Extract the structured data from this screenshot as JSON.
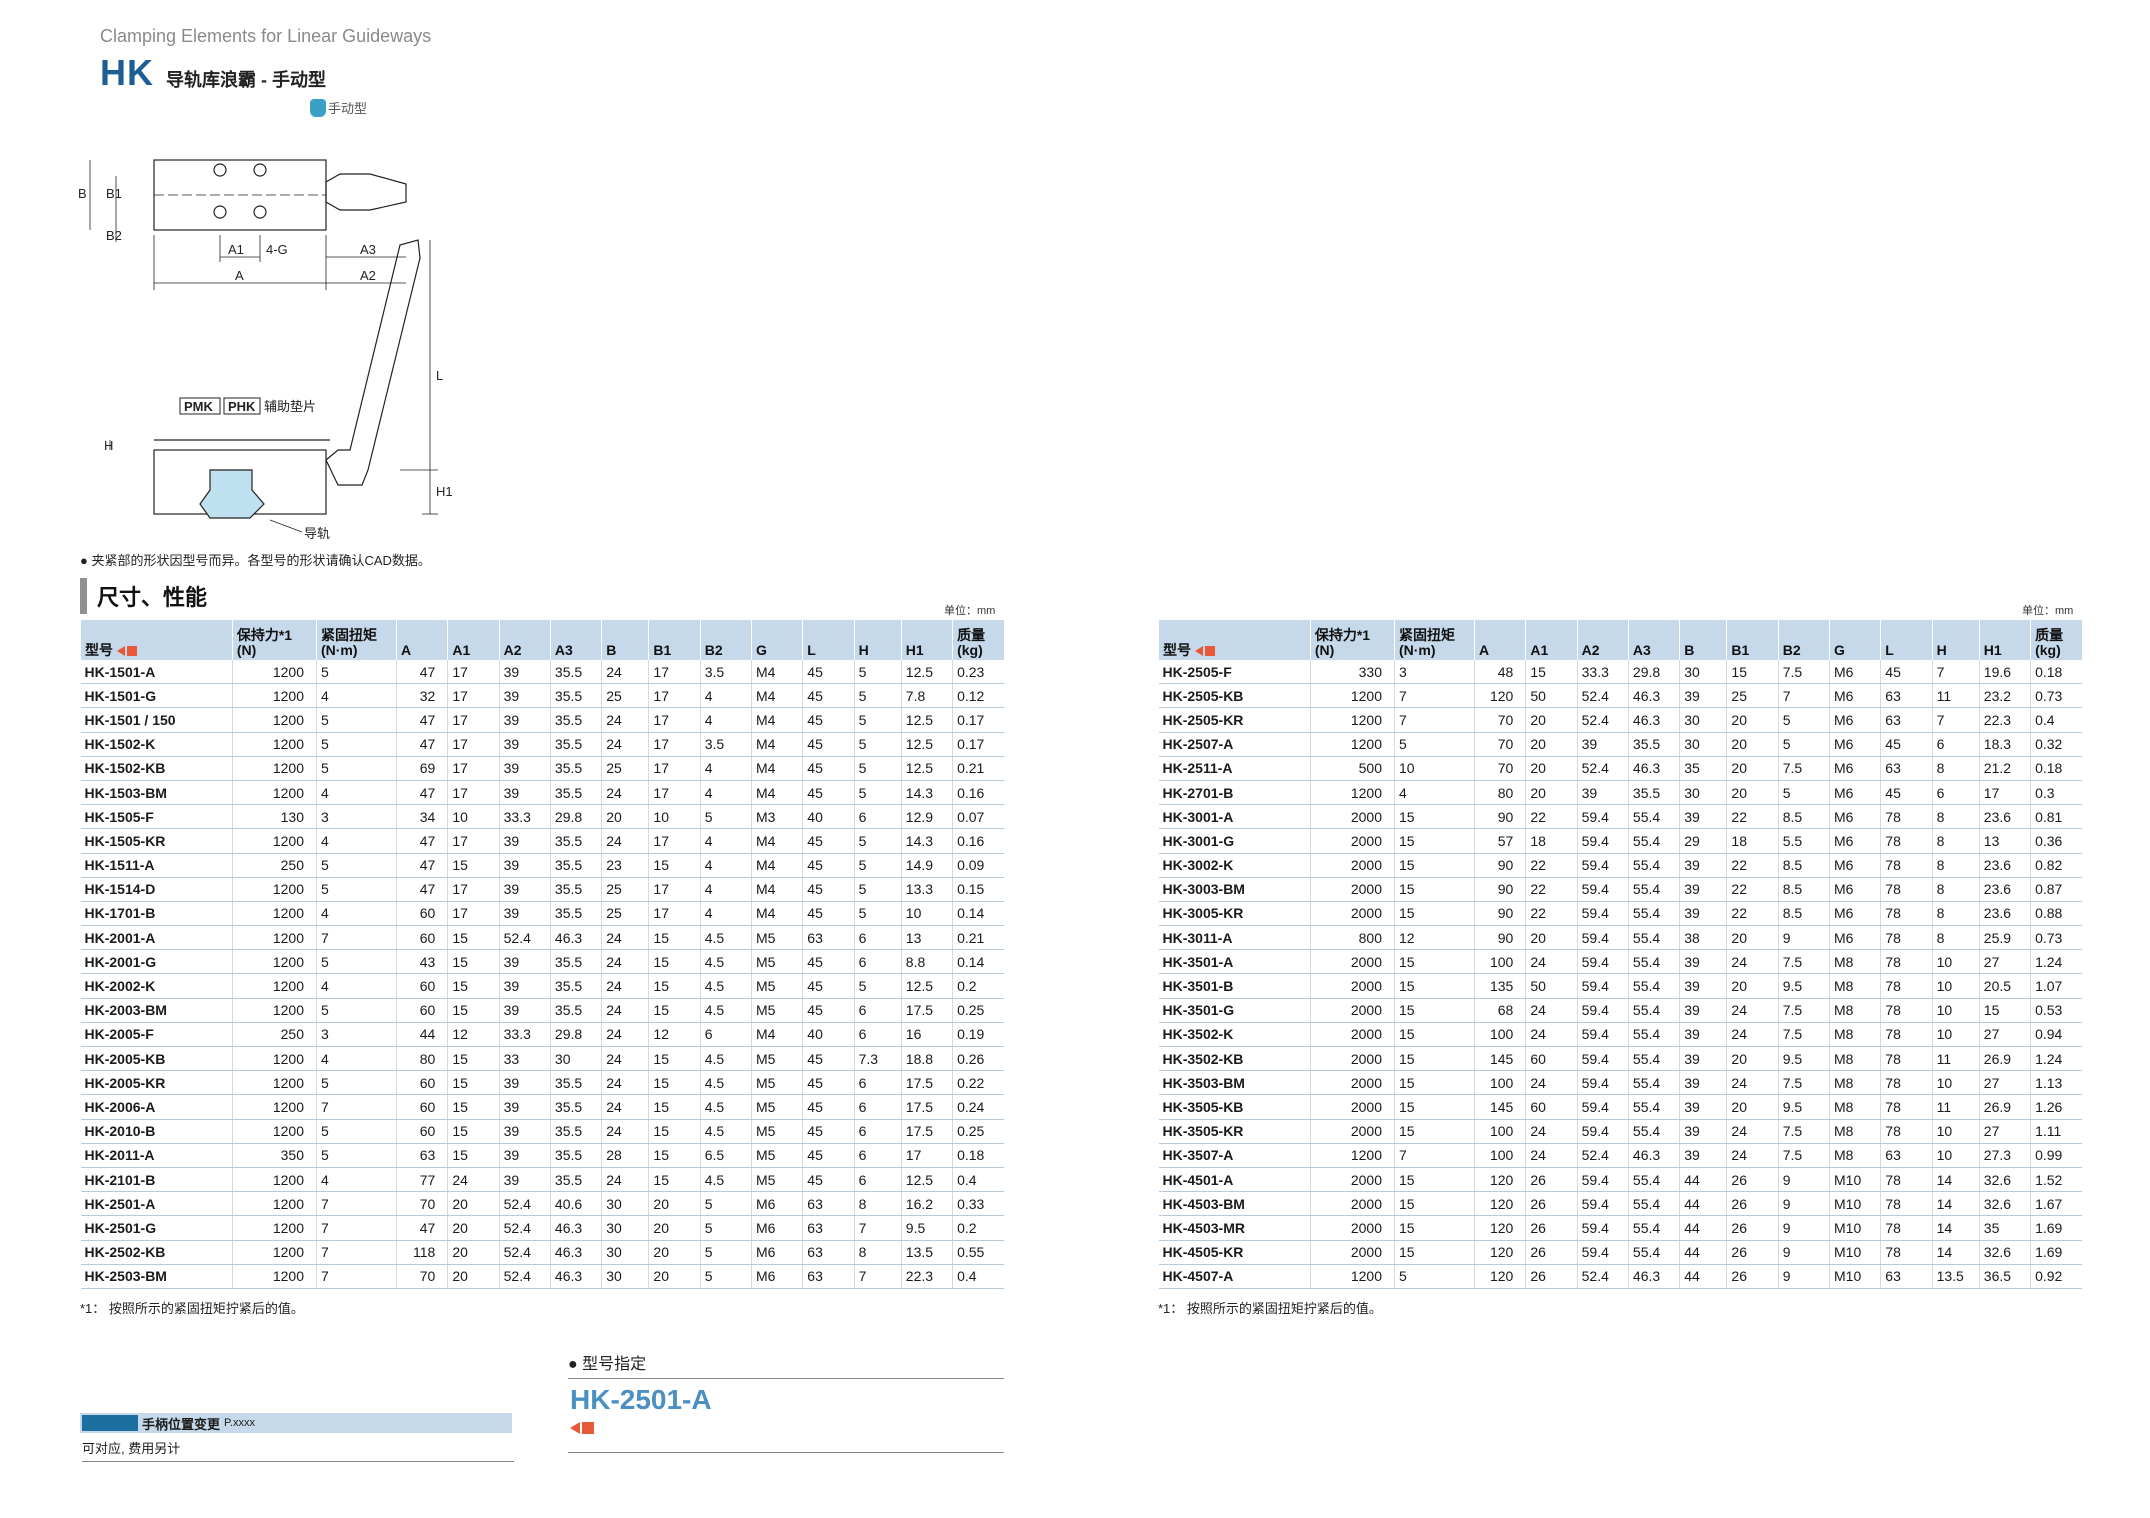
{
  "header": {
    "subtitle": "Clamping Elements for Linear Guideways",
    "code": "HK",
    "description": "导轨库浪霸 - 手动型",
    "type_badge": "手动型"
  },
  "drawing": {
    "top_labels": [
      "B",
      "B1",
      "B2",
      "A1",
      "4-G",
      "A3",
      "A",
      "A2"
    ],
    "side_labels": [
      "H",
      "L",
      "H1"
    ],
    "pmk": "PMK",
    "phk": "PHK",
    "pad_label": "辅助垫片",
    "rail_label": "导轨"
  },
  "note": "● 夹紧部的形状因型号而异。各型号的形状请确认CAD数据。",
  "section": {
    "title": "尺寸、性能",
    "unit": "单位：mm"
  },
  "columns": [
    "型号",
    "保持力*1 (N)",
    "紧固扭矩 (N·m)",
    "A",
    "A1",
    "A2",
    "A3",
    "B",
    "B1",
    "B2",
    "G",
    "L",
    "H",
    "H1",
    "质量 (kg)"
  ],
  "table_left": [
    [
      "HK-1501-A",
      "1200",
      "5",
      "47",
      "17",
      "39",
      "35.5",
      "24",
      "17",
      "3.5",
      "M4",
      "45",
      "5",
      "12.5",
      "0.23"
    ],
    [
      "HK-1501-G",
      "1200",
      "4",
      "32",
      "17",
      "39",
      "35.5",
      "25",
      "17",
      "4",
      "M4",
      "45",
      "5",
      "7.8",
      "0.12"
    ],
    [
      "HK-1501 / 150",
      "1200",
      "5",
      "47",
      "17",
      "39",
      "35.5",
      "24",
      "17",
      "4",
      "M4",
      "45",
      "5",
      "12.5",
      "0.17"
    ],
    [
      "HK-1502-K",
      "1200",
      "5",
      "47",
      "17",
      "39",
      "35.5",
      "24",
      "17",
      "3.5",
      "M4",
      "45",
      "5",
      "12.5",
      "0.17"
    ],
    [
      "HK-1502-KB",
      "1200",
      "5",
      "69",
      "17",
      "39",
      "35.5",
      "25",
      "17",
      "4",
      "M4",
      "45",
      "5",
      "12.5",
      "0.21"
    ],
    [
      "HK-1503-BM",
      "1200",
      "4",
      "47",
      "17",
      "39",
      "35.5",
      "24",
      "17",
      "4",
      "M4",
      "45",
      "5",
      "14.3",
      "0.16"
    ],
    [
      "HK-1505-F",
      "130",
      "3",
      "34",
      "10",
      "33.3",
      "29.8",
      "20",
      "10",
      "5",
      "M3",
      "40",
      "6",
      "12.9",
      "0.07"
    ],
    [
      "HK-1505-KR",
      "1200",
      "4",
      "47",
      "17",
      "39",
      "35.5",
      "24",
      "17",
      "4",
      "M4",
      "45",
      "5",
      "14.3",
      "0.16"
    ],
    [
      "HK-1511-A",
      "250",
      "5",
      "47",
      "15",
      "39",
      "35.5",
      "23",
      "15",
      "4",
      "M4",
      "45",
      "5",
      "14.9",
      "0.09"
    ],
    [
      "HK-1514-D",
      "1200",
      "5",
      "47",
      "17",
      "39",
      "35.5",
      "25",
      "17",
      "4",
      "M4",
      "45",
      "5",
      "13.3",
      "0.15"
    ],
    [
      "HK-1701-B",
      "1200",
      "4",
      "60",
      "17",
      "39",
      "35.5",
      "25",
      "17",
      "4",
      "M4",
      "45",
      "5",
      "10",
      "0.14"
    ],
    [
      "HK-2001-A",
      "1200",
      "7",
      "60",
      "15",
      "52.4",
      "46.3",
      "24",
      "15",
      "4.5",
      "M5",
      "63",
      "6",
      "13",
      "0.21"
    ],
    [
      "HK-2001-G",
      "1200",
      "5",
      "43",
      "15",
      "39",
      "35.5",
      "24",
      "15",
      "4.5",
      "M5",
      "45",
      "6",
      "8.8",
      "0.14"
    ],
    [
      "HK-2002-K",
      "1200",
      "4",
      "60",
      "15",
      "39",
      "35.5",
      "24",
      "15",
      "4.5",
      "M5",
      "45",
      "5",
      "12.5",
      "0.2"
    ],
    [
      "HK-2003-BM",
      "1200",
      "5",
      "60",
      "15",
      "39",
      "35.5",
      "24",
      "15",
      "4.5",
      "M5",
      "45",
      "6",
      "17.5",
      "0.25"
    ],
    [
      "HK-2005-F",
      "250",
      "3",
      "44",
      "12",
      "33.3",
      "29.8",
      "24",
      "12",
      "6",
      "M4",
      "40",
      "6",
      "16",
      "0.19"
    ],
    [
      "HK-2005-KB",
      "1200",
      "4",
      "80",
      "15",
      "33",
      "30",
      "24",
      "15",
      "4.5",
      "M5",
      "45",
      "7.3",
      "18.8",
      "0.26"
    ],
    [
      "HK-2005-KR",
      "1200",
      "5",
      "60",
      "15",
      "39",
      "35.5",
      "24",
      "15",
      "4.5",
      "M5",
      "45",
      "6",
      "17.5",
      "0.22"
    ],
    [
      "HK-2006-A",
      "1200",
      "7",
      "60",
      "15",
      "39",
      "35.5",
      "24",
      "15",
      "4.5",
      "M5",
      "45",
      "6",
      "17.5",
      "0.24"
    ],
    [
      "HK-2010-B",
      "1200",
      "5",
      "60",
      "15",
      "39",
      "35.5",
      "24",
      "15",
      "4.5",
      "M5",
      "45",
      "6",
      "17.5",
      "0.25"
    ],
    [
      "HK-2011-A",
      "350",
      "5",
      "63",
      "15",
      "39",
      "35.5",
      "28",
      "15",
      "6.5",
      "M5",
      "45",
      "6",
      "17",
      "0.18"
    ],
    [
      "HK-2101-B",
      "1200",
      "4",
      "77",
      "24",
      "39",
      "35.5",
      "24",
      "15",
      "4.5",
      "M5",
      "45",
      "6",
      "12.5",
      "0.4"
    ],
    [
      "HK-2501-A",
      "1200",
      "7",
      "70",
      "20",
      "52.4",
      "40.6",
      "30",
      "20",
      "5",
      "M6",
      "63",
      "8",
      "16.2",
      "0.33"
    ],
    [
      "HK-2501-G",
      "1200",
      "7",
      "47",
      "20",
      "52.4",
      "46.3",
      "30",
      "20",
      "5",
      "M6",
      "63",
      "7",
      "9.5",
      "0.2"
    ],
    [
      "HK-2502-KB",
      "1200",
      "7",
      "118",
      "20",
      "52.4",
      "46.3",
      "30",
      "20",
      "5",
      "M6",
      "63",
      "8",
      "13.5",
      "0.55"
    ],
    [
      "HK-2503-BM",
      "1200",
      "7",
      "70",
      "20",
      "52.4",
      "46.3",
      "30",
      "20",
      "5",
      "M6",
      "63",
      "7",
      "22.3",
      "0.4"
    ]
  ],
  "table_right": [
    [
      "HK-2505-F",
      "330",
      "3",
      "48",
      "15",
      "33.3",
      "29.8",
      "30",
      "15",
      "7.5",
      "M6",
      "45",
      "7",
      "19.6",
      "0.18"
    ],
    [
      "HK-2505-KB",
      "1200",
      "7",
      "120",
      "50",
      "52.4",
      "46.3",
      "39",
      "25",
      "7",
      "M6",
      "63",
      "11",
      "23.2",
      "0.73"
    ],
    [
      "HK-2505-KR",
      "1200",
      "7",
      "70",
      "20",
      "52.4",
      "46.3",
      "30",
      "20",
      "5",
      "M6",
      "63",
      "7",
      "22.3",
      "0.4"
    ],
    [
      "HK-2507-A",
      "1200",
      "5",
      "70",
      "20",
      "39",
      "35.5",
      "30",
      "20",
      "5",
      "M6",
      "45",
      "6",
      "18.3",
      "0.32"
    ],
    [
      "HK-2511-A",
      "500",
      "10",
      "70",
      "20",
      "52.4",
      "46.3",
      "35",
      "20",
      "7.5",
      "M6",
      "63",
      "8",
      "21.2",
      "0.18"
    ],
    [
      "HK-2701-B",
      "1200",
      "4",
      "80",
      "20",
      "39",
      "35.5",
      "30",
      "20",
      "5",
      "M6",
      "45",
      "6",
      "17",
      "0.3"
    ],
    [
      "HK-3001-A",
      "2000",
      "15",
      "90",
      "22",
      "59.4",
      "55.4",
      "39",
      "22",
      "8.5",
      "M6",
      "78",
      "8",
      "23.6",
      "0.81"
    ],
    [
      "HK-3001-G",
      "2000",
      "15",
      "57",
      "18",
      "59.4",
      "55.4",
      "29",
      "18",
      "5.5",
      "M6",
      "78",
      "8",
      "13",
      "0.36"
    ],
    [
      "HK-3002-K",
      "2000",
      "15",
      "90",
      "22",
      "59.4",
      "55.4",
      "39",
      "22",
      "8.5",
      "M6",
      "78",
      "8",
      "23.6",
      "0.82"
    ],
    [
      "HK-3003-BM",
      "2000",
      "15",
      "90",
      "22",
      "59.4",
      "55.4",
      "39",
      "22",
      "8.5",
      "M6",
      "78",
      "8",
      "23.6",
      "0.87"
    ],
    [
      "HK-3005-KR",
      "2000",
      "15",
      "90",
      "22",
      "59.4",
      "55.4",
      "39",
      "22",
      "8.5",
      "M6",
      "78",
      "8",
      "23.6",
      "0.88"
    ],
    [
      "HK-3011-A",
      "800",
      "12",
      "90",
      "20",
      "59.4",
      "55.4",
      "38",
      "20",
      "9",
      "M6",
      "78",
      "8",
      "25.9",
      "0.73"
    ],
    [
      "HK-3501-A",
      "2000",
      "15",
      "100",
      "24",
      "59.4",
      "55.4",
      "39",
      "24",
      "7.5",
      "M8",
      "78",
      "10",
      "27",
      "1.24"
    ],
    [
      "HK-3501-B",
      "2000",
      "15",
      "135",
      "50",
      "59.4",
      "55.4",
      "39",
      "20",
      "9.5",
      "M8",
      "78",
      "10",
      "20.5",
      "1.07"
    ],
    [
      "HK-3501-G",
      "2000",
      "15",
      "68",
      "24",
      "59.4",
      "55.4",
      "39",
      "24",
      "7.5",
      "M8",
      "78",
      "10",
      "15",
      "0.53"
    ],
    [
      "HK-3502-K",
      "2000",
      "15",
      "100",
      "24",
      "59.4",
      "55.4",
      "39",
      "24",
      "7.5",
      "M8",
      "78",
      "10",
      "27",
      "0.94"
    ],
    [
      "HK-3502-KB",
      "2000",
      "15",
      "145",
      "60",
      "59.4",
      "55.4",
      "39",
      "20",
      "9.5",
      "M8",
      "78",
      "11",
      "26.9",
      "1.24"
    ],
    [
      "HK-3503-BM",
      "2000",
      "15",
      "100",
      "24",
      "59.4",
      "55.4",
      "39",
      "24",
      "7.5",
      "M8",
      "78",
      "10",
      "27",
      "1.13"
    ],
    [
      "HK-3505-KB",
      "2000",
      "15",
      "145",
      "60",
      "59.4",
      "55.4",
      "39",
      "20",
      "9.5",
      "M8",
      "78",
      "11",
      "26.9",
      "1.26"
    ],
    [
      "HK-3505-KR",
      "2000",
      "15",
      "100",
      "24",
      "59.4",
      "55.4",
      "39",
      "24",
      "7.5",
      "M8",
      "78",
      "10",
      "27",
      "1.11"
    ],
    [
      "HK-3507-A",
      "1200",
      "7",
      "100",
      "24",
      "52.4",
      "46.3",
      "39",
      "24",
      "7.5",
      "M8",
      "63",
      "10",
      "27.3",
      "0.99"
    ],
    [
      "HK-4501-A",
      "2000",
      "15",
      "120",
      "26",
      "59.4",
      "55.4",
      "44",
      "26",
      "9",
      "M10",
      "78",
      "14",
      "32.6",
      "1.52"
    ],
    [
      "HK-4503-BM",
      "2000",
      "15",
      "120",
      "26",
      "59.4",
      "55.4",
      "44",
      "26",
      "9",
      "M10",
      "78",
      "14",
      "32.6",
      "1.67"
    ],
    [
      "HK-4503-MR",
      "2000",
      "15",
      "120",
      "26",
      "59.4",
      "55.4",
      "44",
      "26",
      "9",
      "M10",
      "78",
      "14",
      "35",
      "1.69"
    ],
    [
      "HK-4505-KR",
      "2000",
      "15",
      "120",
      "26",
      "59.4",
      "55.4",
      "44",
      "26",
      "9",
      "M10",
      "78",
      "14",
      "32.6",
      "1.69"
    ],
    [
      "HK-4507-A",
      "1200",
      "5",
      "120",
      "26",
      "52.4",
      "46.3",
      "44",
      "26",
      "9",
      "M10",
      "63",
      "13.5",
      "36.5",
      "0.92"
    ]
  ],
  "footnote": "*1： 按照所示的紧固扭矩拧紧后的值。",
  "handle_change": {
    "label": "手柄位置变更",
    "ref": "P.xxxx",
    "note": "可对应, 费用另计"
  },
  "order": {
    "title": "● 型号指定",
    "code": "HK-2501-A"
  },
  "colors": {
    "brand": "#1d5f95",
    "header_bg": "#c5d9ea",
    "accent": "#e8593a"
  }
}
